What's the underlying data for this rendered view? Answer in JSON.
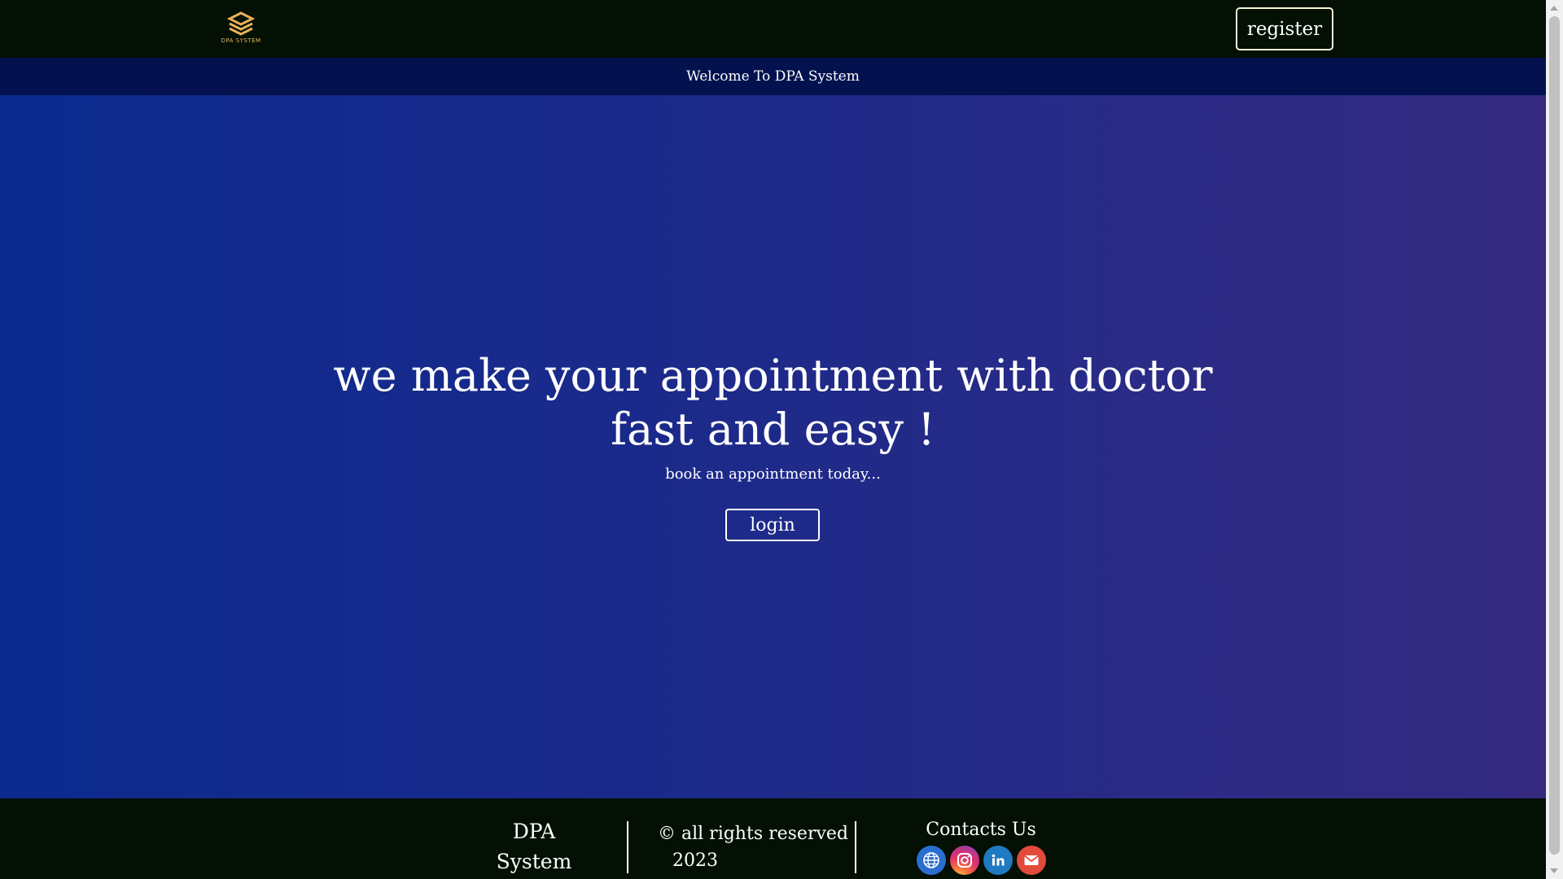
{
  "header": {
    "logo_text": "DPA SYSTEM",
    "register_label": "register"
  },
  "welcome": {
    "text": "Welcome To DPA System"
  },
  "hero": {
    "title_line1": "we make your appointment with doctor",
    "title_line2": "fast and easy !",
    "subtitle": "book an appointment today...",
    "login_label": "login"
  },
  "footer": {
    "brand_line1": "DPA",
    "brand_line2": "System",
    "rights": "© all rights reserved",
    "year": "2023",
    "contacts_title": "Contacts Us",
    "socials": [
      "globe-icon",
      "instagram-icon",
      "linkedin-icon",
      "mail-icon"
    ]
  },
  "colors": {
    "top_bar": "#031003",
    "welcome_bar": "#03124f",
    "hero_start": "#0b2a8e",
    "hero_end": "#34297f",
    "logo_accent": "#e8b25a"
  }
}
